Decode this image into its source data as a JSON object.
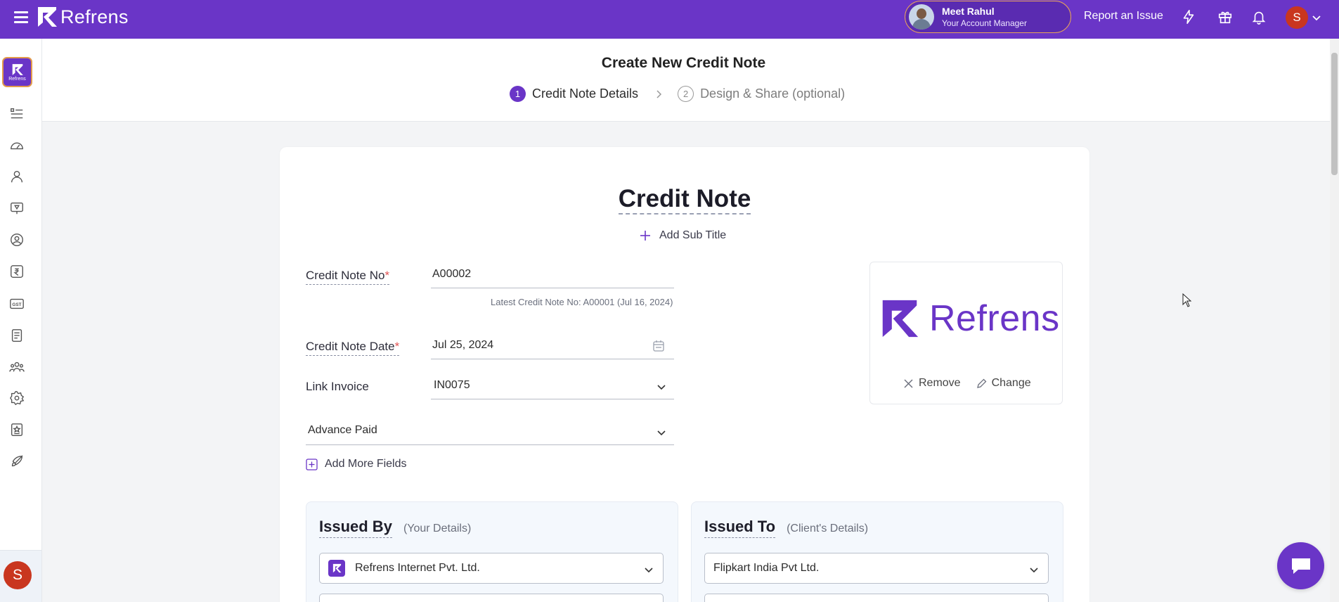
{
  "app": {
    "brand": "Refrens",
    "side_logo_label": "Refrens"
  },
  "topbar": {
    "account_manager": {
      "name": "Meet Rahul",
      "role": "Your Account Manager"
    },
    "report_link": "Report an Issue",
    "user_initial": "S",
    "icons": [
      "lightning-icon",
      "gift-icon",
      "bell-icon"
    ]
  },
  "sidebar": {
    "icons": [
      "list-icon",
      "dashboard-icon",
      "user-icon",
      "presentation-icon",
      "contact-icon",
      "rupee-icon",
      "gst-icon",
      "document-icon",
      "team-icon",
      "settings-icon",
      "badge-icon",
      "rocket-icon"
    ],
    "user_initial": "S"
  },
  "header": {
    "title": "Create New Credit Note",
    "steps": [
      {
        "num": "1",
        "label": "Credit Note Details",
        "active": true
      },
      {
        "num": "2",
        "label": "Design & Share (optional)",
        "active": false
      }
    ]
  },
  "form": {
    "doc_title": "Credit Note",
    "add_subtitle": "Add Sub Title",
    "credit_note_no": {
      "label": "Credit Note No",
      "value": "A00002",
      "hint": "Latest Credit Note No: A00001 (Jul 16, 2024)"
    },
    "credit_note_date": {
      "label": "Credit Note Date",
      "value": "Jul 25, 2024"
    },
    "link_invoice": {
      "label": "Link Invoice",
      "value": "IN0075"
    },
    "advance_paid": {
      "label": "Advance Paid"
    },
    "add_more_fields": "Add More Fields",
    "logo": {
      "text": "Refrens",
      "remove": "Remove",
      "change": "Change"
    }
  },
  "issued_by": {
    "title": "Issued By",
    "subtitle": "(Your Details)",
    "selected": "Refrens Internet Pvt. Ltd."
  },
  "issued_to": {
    "title": "Issued To",
    "subtitle": "(Client's Details)",
    "selected": "Flipkart India Pvt Ltd."
  },
  "colors": {
    "brand": "#6a35c7",
    "accent_border": "#e39b4b",
    "avatar": "#c9361f",
    "required": "#e25555"
  }
}
